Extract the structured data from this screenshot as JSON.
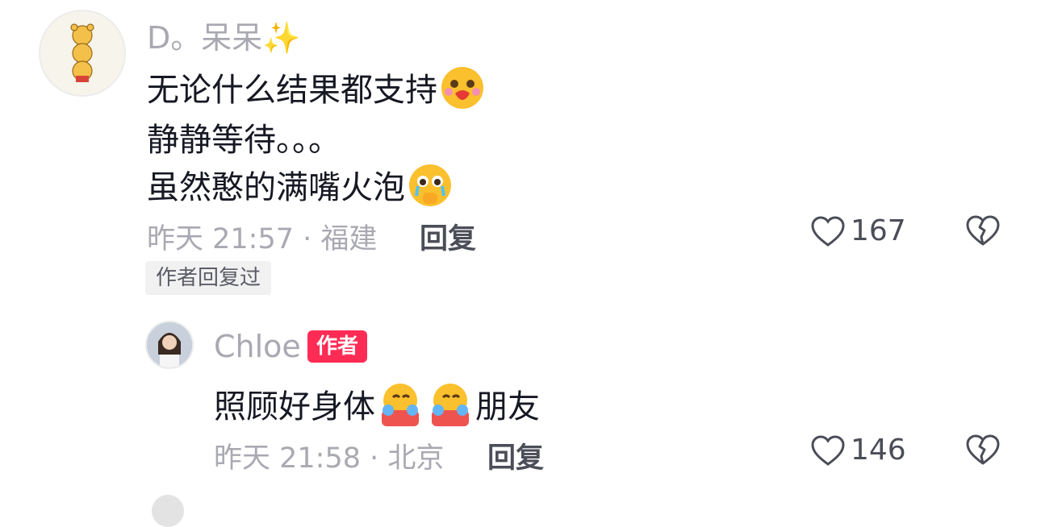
{
  "comment": {
    "username": "D。呆呆✨",
    "lines": [
      "无论什么结果都支持",
      "静静等待。。。",
      "虽然憨的满嘴火泡"
    ],
    "time_location": "昨天 21:57 · 福建",
    "reply_label": "回复",
    "likes": "167",
    "author_replied_tag": "作者回复过",
    "emoji_line1": "smiling-face-with-heart-emoji",
    "emoji_line3": "pleading-face-emoji"
  },
  "reply": {
    "username": "Chloe",
    "author_badge": "作者",
    "text_part1": "照顾好身体",
    "text_part2": "朋友",
    "time_location": "昨天 21:58 · 北京",
    "reply_label": "回复",
    "likes": "146",
    "emoji": "hugging-face-emoji"
  },
  "colors": {
    "text_primary": "#161823",
    "text_secondary": "#a9a9b2",
    "author_badge_bg": "#fe2c55"
  }
}
